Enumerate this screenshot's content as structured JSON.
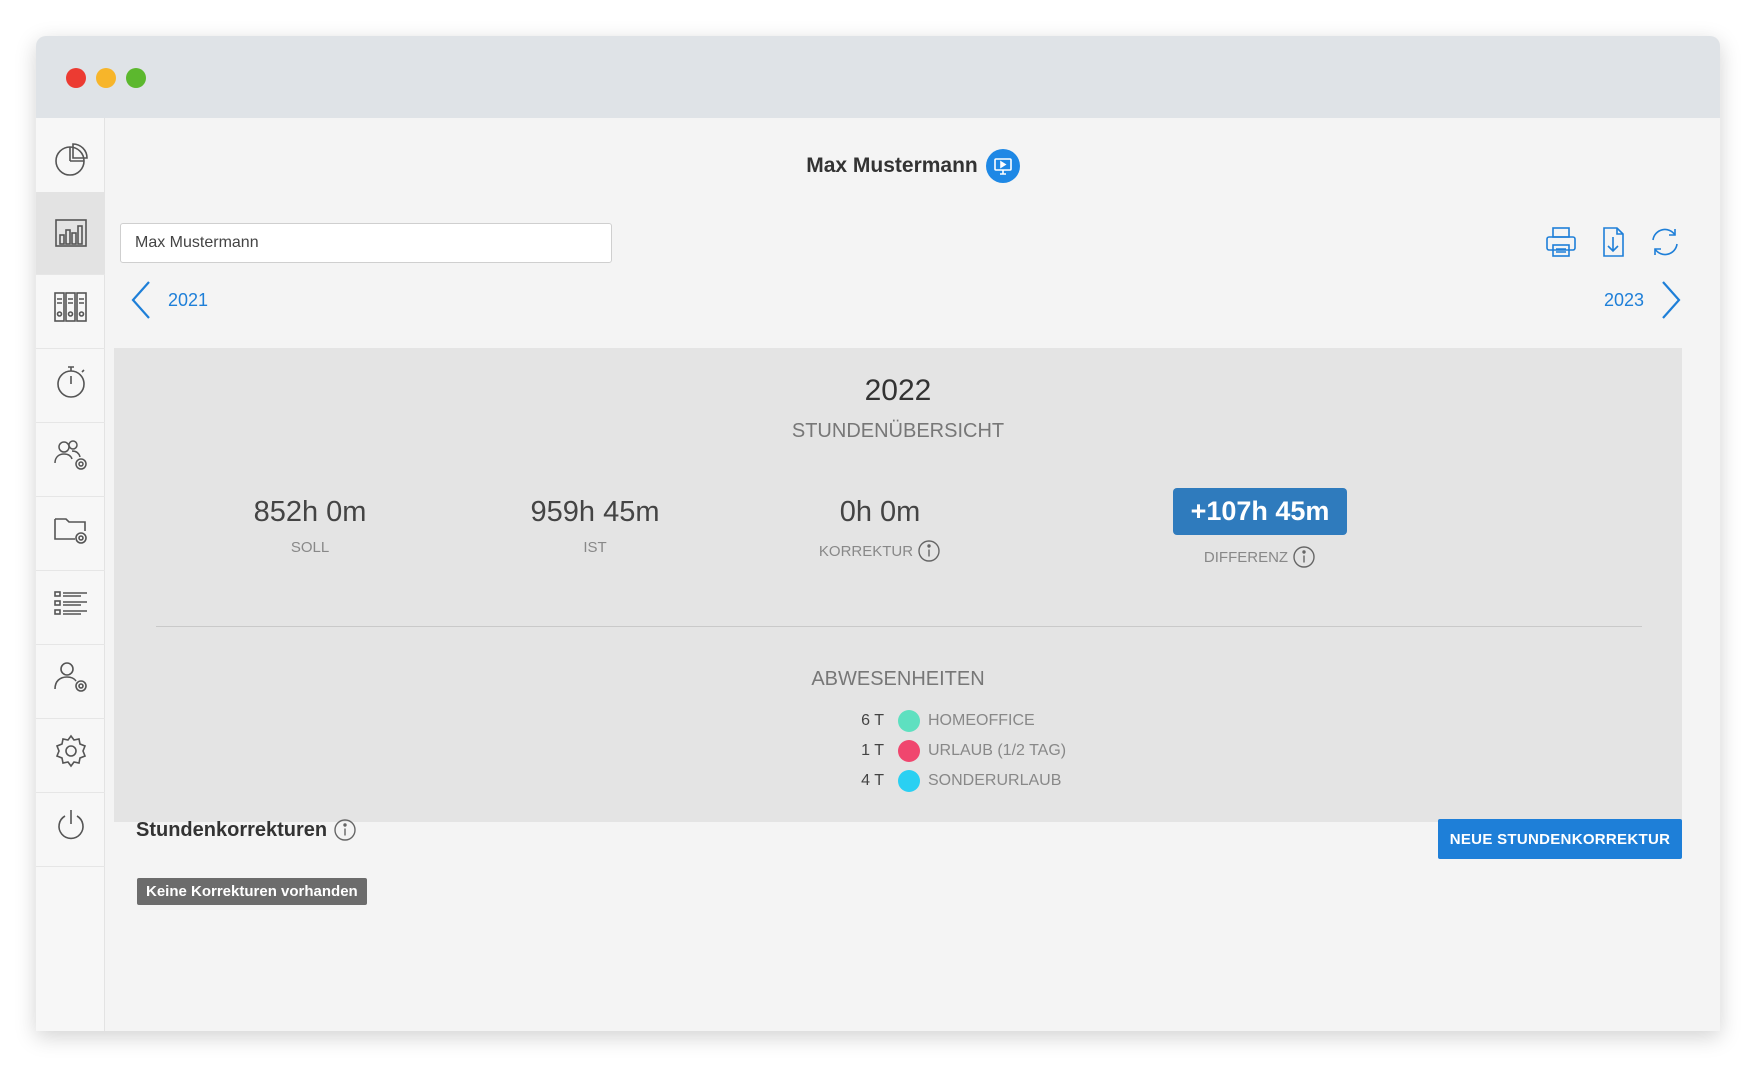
{
  "window": {
    "controls": [
      "close",
      "minimize",
      "maximize"
    ]
  },
  "sidebar": {
    "items": [
      {
        "icon": "pie-chart-icon"
      },
      {
        "icon": "bar-chart-icon",
        "active": true
      },
      {
        "icon": "binders-icon"
      },
      {
        "icon": "stopwatch-icon"
      },
      {
        "icon": "group-settings-icon"
      },
      {
        "icon": "folder-settings-icon"
      },
      {
        "icon": "list-icon"
      },
      {
        "icon": "user-settings-icon"
      },
      {
        "icon": "gear-icon"
      },
      {
        "icon": "power-icon"
      }
    ]
  },
  "header": {
    "name": "Max Mustermann",
    "badge_icon": "monitor-icon"
  },
  "employee_select": {
    "value": "Max Mustermann"
  },
  "toolbar": {
    "icons": [
      "printer-icon",
      "download-document-icon",
      "refresh-icon"
    ]
  },
  "nav": {
    "prev_year": "2021",
    "next_year": "2023"
  },
  "summary": {
    "year": "2022",
    "subtitle": "STUNDENÜBERSICHT",
    "soll": {
      "value": "852h 0m",
      "label": "SOLL"
    },
    "ist": {
      "value": "959h 45m",
      "label": "IST"
    },
    "korrektur": {
      "value": "0h 0m",
      "label": "KORREKTUR"
    },
    "differenz": {
      "value": "+107h 45m",
      "label": "DIFFERENZ"
    },
    "accent_color": "#2f7bbd"
  },
  "absences": {
    "title": "ABWESENHEITEN",
    "items": [
      {
        "count": "6 T",
        "label": "HOMEOFFICE",
        "color": "#5ee0c0"
      },
      {
        "count": "1 T",
        "label": "URLAUB (1/2 TAG)",
        "color": "#f0466e"
      },
      {
        "count": "4 T",
        "label": "SONDERURLAUB",
        "color": "#2ad0f2"
      }
    ]
  },
  "corrections": {
    "title": "Stundenkorrekturen",
    "new_button": "NEUE STUNDENKORREKTUR",
    "empty": "Keine Korrekturen vorhanden"
  }
}
